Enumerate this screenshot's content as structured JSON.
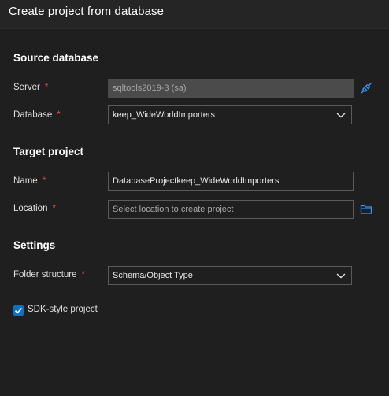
{
  "dialog": {
    "title": "Create project from database"
  },
  "source": {
    "title": "Source database",
    "server_label": "Server",
    "server_value": "sqltools2019-3 (sa)",
    "database_label": "Database",
    "database_value": "keep_WideWorldImporters"
  },
  "target": {
    "title": "Target project",
    "name_label": "Name",
    "name_value": "DatabaseProjectkeep_WideWorldImporters",
    "location_label": "Location",
    "location_placeholder": "Select location to create project"
  },
  "settings": {
    "title": "Settings",
    "folder_label": "Folder structure",
    "folder_value": "Schema/Object Type",
    "sdk_label": "SDK-style project",
    "sdk_checked": true
  },
  "required_mark": "*",
  "colors": {
    "accent": "#3794ff",
    "required": "#f14c4c",
    "checkbox": "#0e70c0"
  }
}
